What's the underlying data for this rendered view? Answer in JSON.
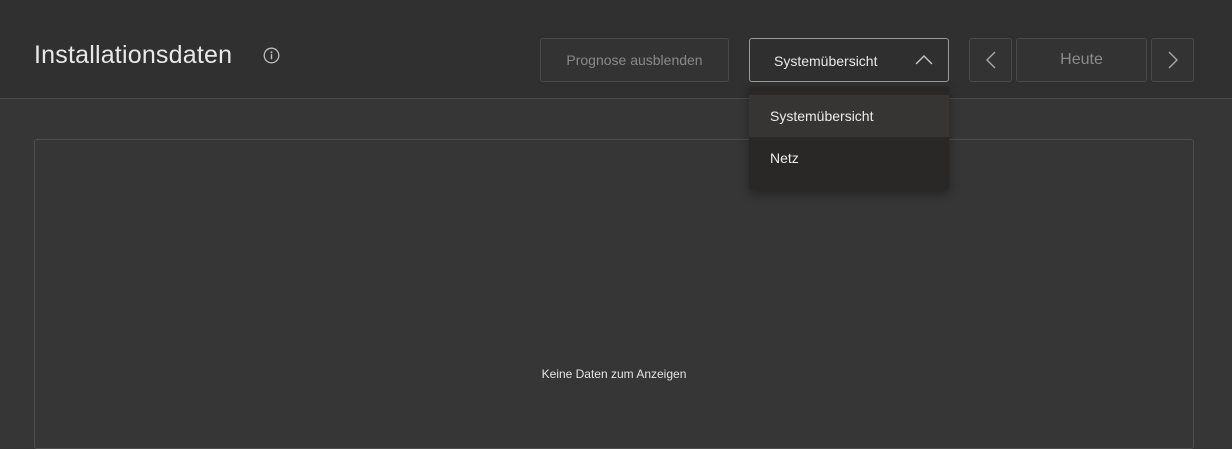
{
  "header": {
    "title": "Installationsdaten",
    "info_icon": "info-icon",
    "forecast_button_label": "Prognose ausblenden"
  },
  "view_select": {
    "selected": "Systemübersicht",
    "icon": "chevron-up-icon",
    "options": [
      {
        "label": "Systemübersicht",
        "active": true
      },
      {
        "label": "Netz",
        "active": false
      }
    ]
  },
  "date_nav": {
    "prev_icon": "chevron-left-icon",
    "today_label": "Heute",
    "next_icon": "chevron-right-icon"
  },
  "chart": {
    "empty_message": "Keine Daten zum Anzeigen"
  },
  "colors": {
    "background": "#363636",
    "header_background": "#303030",
    "dropdown_background": "#292826",
    "text_primary": "#e8e8e8",
    "text_muted": "#8a8a8a"
  }
}
